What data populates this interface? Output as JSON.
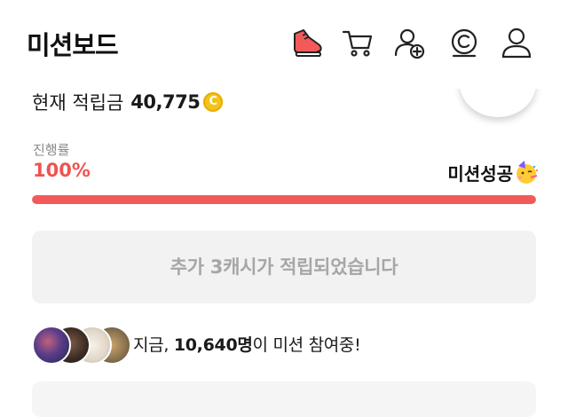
{
  "header": {
    "title": "미션보드",
    "icons": [
      "sneaker-icon",
      "cart-icon",
      "add-friend-icon",
      "copyright-coin-icon",
      "profile-icon"
    ]
  },
  "balance": {
    "label": "현재 적립금",
    "amount": "40,775",
    "coin_icon": "coin-icon"
  },
  "progress": {
    "label": "진행률",
    "value": "100%",
    "fraction": 1.0,
    "status": "미션성공",
    "status_icon": "party-face-icon"
  },
  "cash_button": {
    "label": "추가 3캐시가 적립되었습니다"
  },
  "participants": {
    "prefix": "지금, ",
    "count": "10,640명",
    "suffix": "이 미션 참여중!"
  },
  "colors": {
    "accent": "#f25a5a",
    "progress_text": "#ef5350",
    "coin": "#f4c31a",
    "button_bg": "#f2f2f2",
    "button_text": "#a6a6a6"
  }
}
